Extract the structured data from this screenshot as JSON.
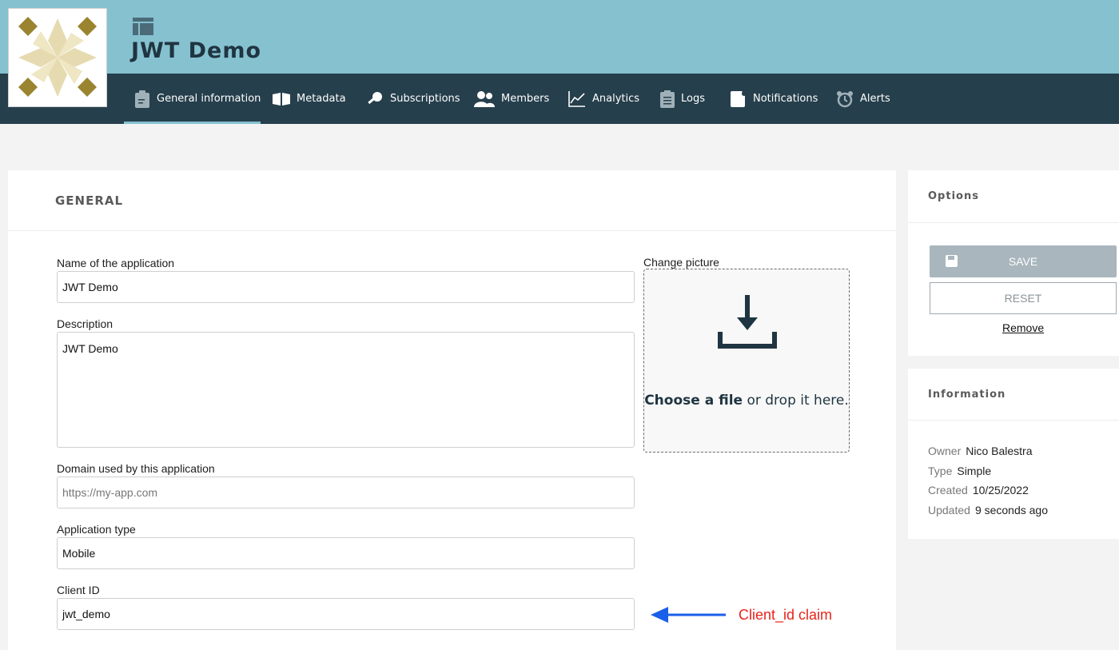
{
  "header": {
    "app_title": "JWT Demo",
    "tabs": [
      {
        "label": "General information",
        "icon": "clipboard-icon",
        "active": true
      },
      {
        "label": "Metadata",
        "icon": "book-icon"
      },
      {
        "label": "Subscriptions",
        "icon": "key-icon"
      },
      {
        "label": "Members",
        "icon": "users-icon"
      },
      {
        "label": "Analytics",
        "icon": "chart-icon"
      },
      {
        "label": "Logs",
        "icon": "list-icon"
      },
      {
        "label": "Notifications",
        "icon": "bell-doc-icon"
      },
      {
        "label": "Alerts",
        "icon": "alarm-clock-icon"
      }
    ]
  },
  "general": {
    "heading": "GENERAL",
    "name_label": "Name of the application",
    "name_value": "JWT Demo",
    "description_label": "Description",
    "description_value": "JWT Demo",
    "domain_label": "Domain used by this application",
    "domain_placeholder": "https://my-app.com",
    "apptype_label": "Application type",
    "apptype_value": "Mobile",
    "clientid_label": "Client ID",
    "clientid_value": "jwt_demo",
    "picture_label": "Change picture",
    "drop_bold": "Choose a file",
    "drop_rest": " or drop it here."
  },
  "options": {
    "heading": "Options",
    "save_label": "SAVE",
    "reset_label": "RESET",
    "remove_label": "Remove"
  },
  "information": {
    "heading": "Information",
    "rows": [
      {
        "key": "Owner",
        "value": "Nico Balestra"
      },
      {
        "key": "Type",
        "value": "Simple"
      },
      {
        "key": "Created",
        "value": "10/25/2022"
      },
      {
        "key": "Updated",
        "value": "9 seconds ago"
      }
    ]
  },
  "annotation": {
    "text": "Client_id claim",
    "color": "#e8241b",
    "arrow_color": "#1a5fe8"
  },
  "colors": {
    "header_top": "#86c1d0",
    "header_nav": "#263f4c",
    "logo_gold": "#9a8430",
    "logo_light": "#e6dbb0"
  }
}
